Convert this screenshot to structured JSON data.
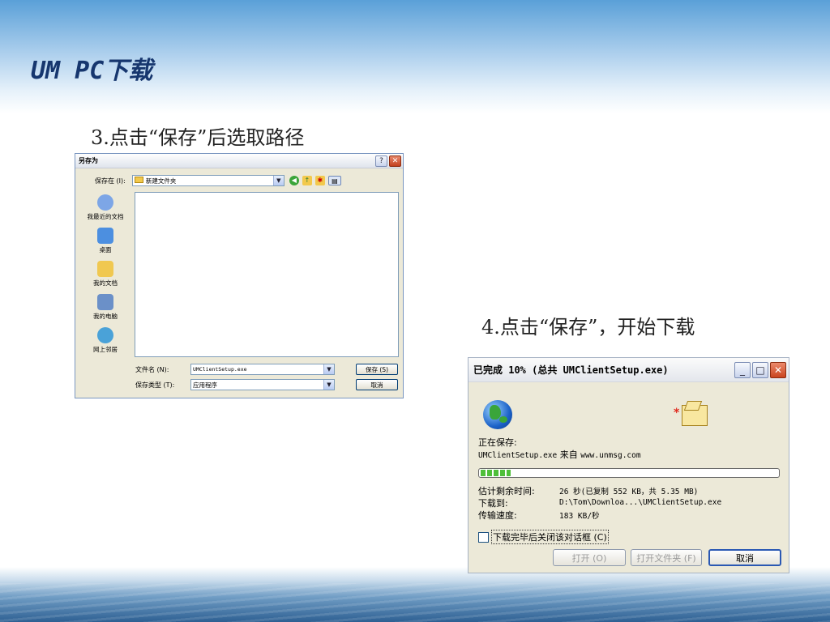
{
  "slide": {
    "title": "UM PC下载",
    "step3": "3.点击“保存”后选取路径",
    "step4": "4.点击“保存”，开始下载"
  },
  "save_dialog": {
    "title": "另存为",
    "help_btn": "?",
    "close_btn": "✕",
    "save_in_label": "保存在 (I):",
    "save_in_value": "新建文件夹",
    "places": [
      {
        "label": "我最近的文档",
        "icon": "recent-docs-icon",
        "color": "#7da6e6"
      },
      {
        "label": "桌面",
        "icon": "desktop-icon",
        "color": "#4c8fe0"
      },
      {
        "label": "我的文档",
        "icon": "my-documents-icon",
        "color": "#f0c850"
      },
      {
        "label": "我的电脑",
        "icon": "my-computer-icon",
        "color": "#6b90c8"
      },
      {
        "label": "网上邻居",
        "icon": "network-icon",
        "color": "#4aa2d8"
      }
    ],
    "filename_label": "文件名 (N):",
    "filename_value": "UMClientSetup.exe",
    "filetype_label": "保存类型 (T):",
    "filetype_value": "应用程序",
    "save_btn": "保存 (S)",
    "cancel_btn": "取消"
  },
  "download_dialog": {
    "title": "已完成 10% (总共 UMClientSetup.exe)",
    "minimize": "_",
    "maximize": "□",
    "close": "✕",
    "saving_label": "正在保存:",
    "saving_file_prefix": "UMClientSetup.exe",
    "saving_from_word": "来自",
    "saving_from_host": "www.unmsg.com",
    "progress": 0.1,
    "eta_label": "估计剩余时间:",
    "eta_value": "26 秒(已复制 552 KB，共 5.35 MB)",
    "dest_label": "下载到:",
    "dest_value": "D:\\Tom\\Downloa...\\UMClientSetup.exe",
    "rate_label": "传输速度:",
    "rate_value": "183 KB/秒",
    "close_on_complete": "下载完毕后关闭该对话框 (C)",
    "open_btn": "打开 (O)",
    "open_folder_btn": "打开文件夹 (F)",
    "cancel_btn": "取消"
  }
}
